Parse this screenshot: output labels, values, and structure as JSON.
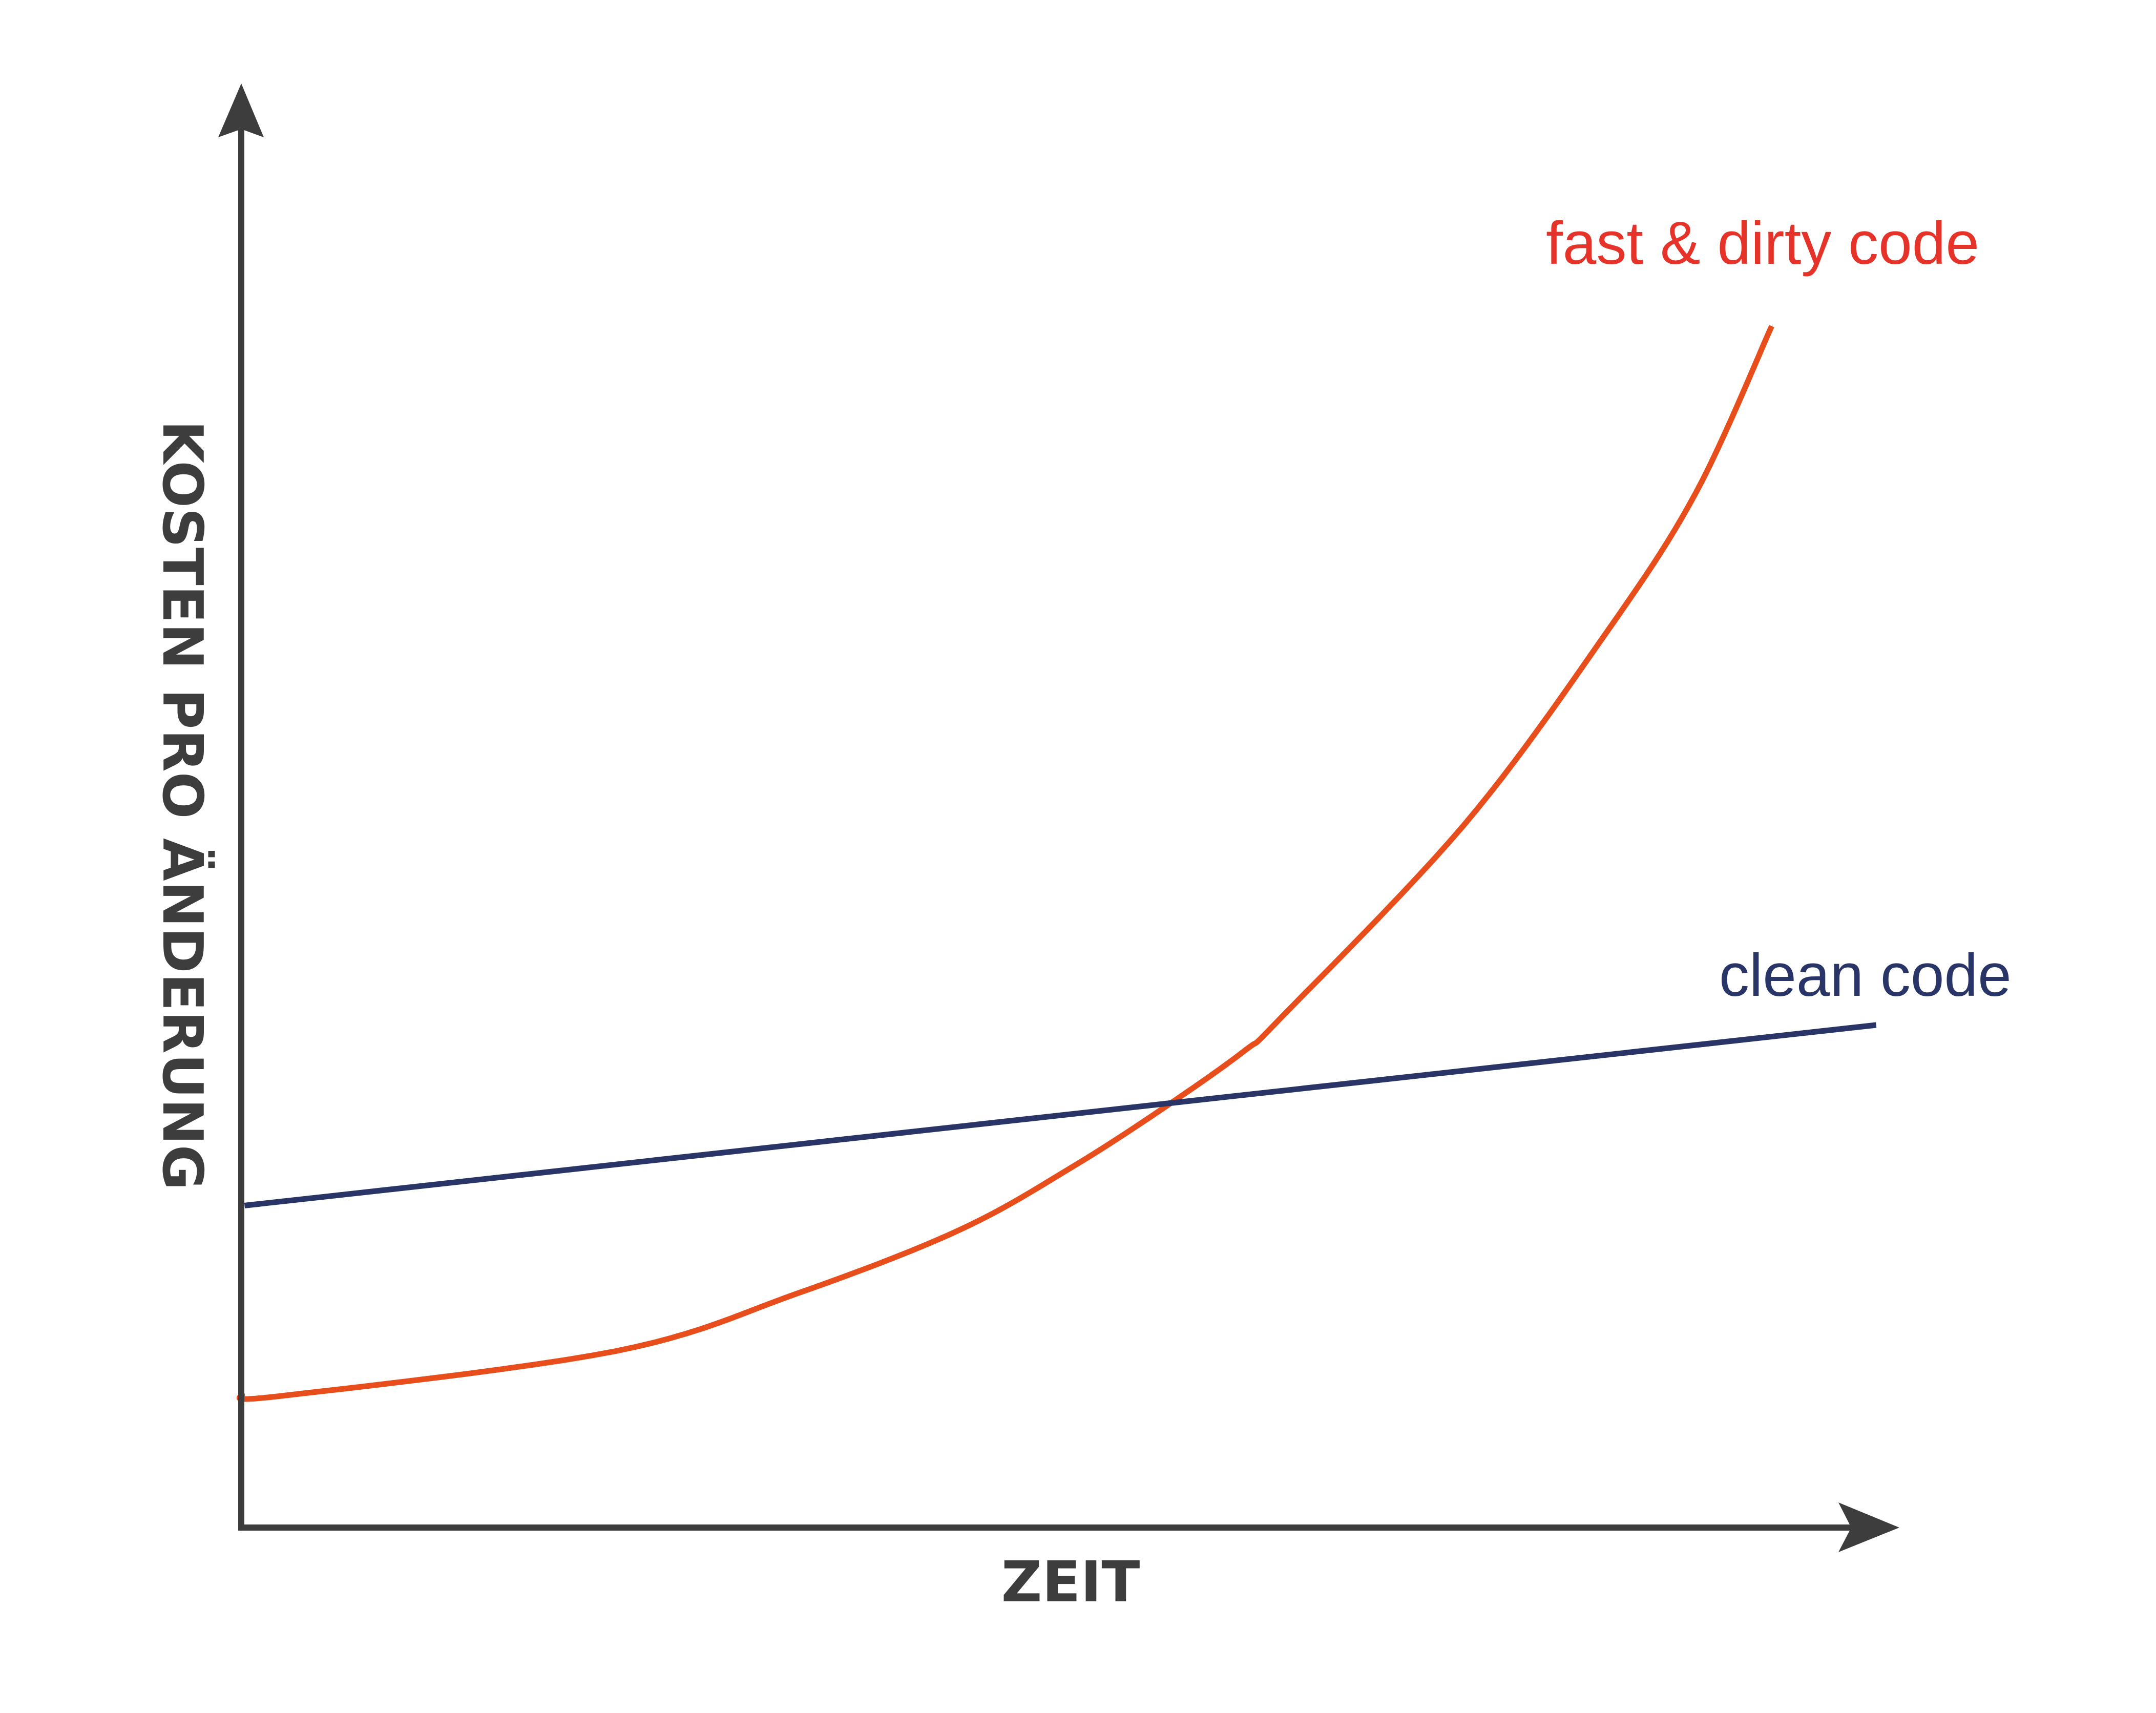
{
  "chart_data": {
    "type": "line",
    "title": "",
    "xlabel": "ZEIT",
    "ylabel": "KOSTEN PRO ÄNDERUNG",
    "xlim": [
      0,
      100
    ],
    "ylim": [
      0,
      100
    ],
    "grid": false,
    "ticks": false,
    "legend": "inline-labels",
    "series": [
      {
        "name": "fast & dirty code",
        "color": "#e84e1b",
        "label_color": "#e63329",
        "x": [
          0,
          2.3,
          22.5,
          33.5,
          43.3,
          50.3,
          56.2,
          60.6,
          62.7,
          73.7,
          82.1,
          87.7,
          92.3
        ],
        "y": [
          9.2,
          9.1,
          12.2,
          16.2,
          20.6,
          25.1,
          29.5,
          33.1,
          35.3,
          48.6,
          61.6,
          71.6,
          83.2
        ]
      },
      {
        "name": "clean code",
        "color": "#283566",
        "label_color": "#283566",
        "x": [
          0.2,
          98.6
        ],
        "y": [
          22.3,
          34.8
        ]
      }
    ],
    "axis_color": "#3d3d3d"
  }
}
